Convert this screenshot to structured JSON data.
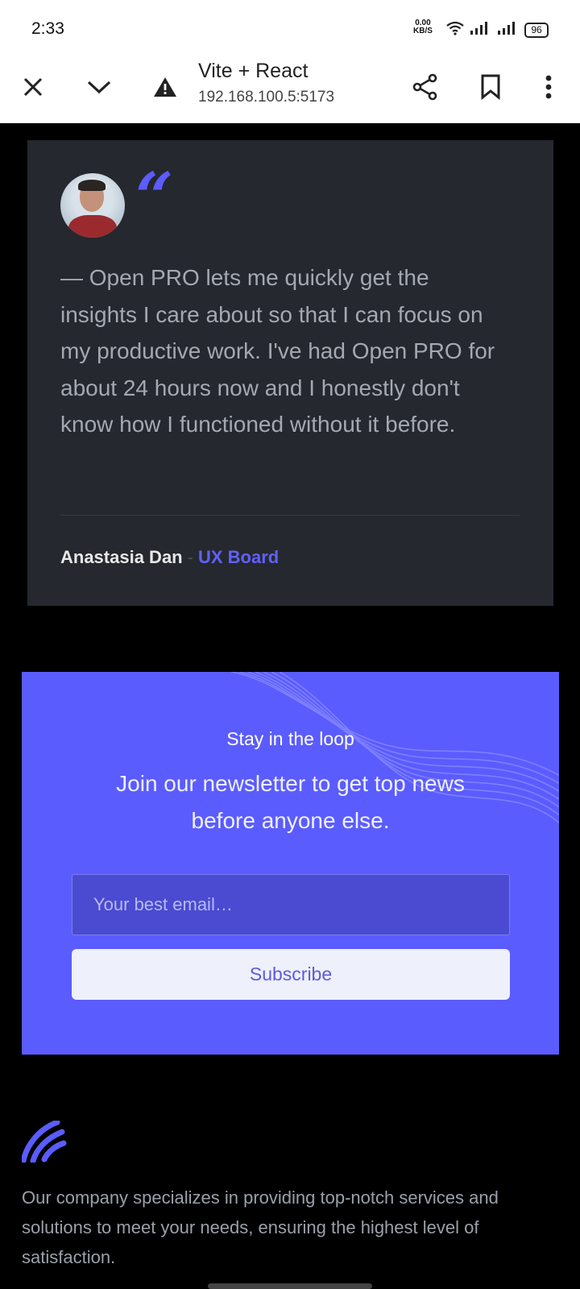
{
  "status_bar": {
    "time": "2:33",
    "net_speed_value": "0.00",
    "net_speed_unit": "KB/S",
    "battery": "96"
  },
  "browser": {
    "page_title": "Vite + React",
    "url": "192.168.100.5:5173",
    "icons": [
      "close-icon",
      "chevron-down-icon",
      "warning-icon",
      "share-icon",
      "bookmark-icon",
      "more-icon"
    ]
  },
  "testimonial": {
    "quote_mark": "“",
    "text": "— Open PRO lets me quickly get the insights I care about so that I can focus on my productive work. I've had Open PRO for about 24 hours now and I honestly don't know how I functioned without it before.",
    "author": "Anastasia Dan",
    "separator": "-",
    "company": "UX Board"
  },
  "newsletter": {
    "kicker": "Stay in the loop",
    "headline": "Join our newsletter to get top news before anyone else.",
    "email_placeholder": "Your best email…",
    "subscribe_label": "Subscribe"
  },
  "footer": {
    "description": "Our company specializes in providing top-notch services and solutions to meet your needs, ensuring the highest level of satisfaction."
  },
  "colors": {
    "accent": "#5b5cfe",
    "card_bg": "#25282e",
    "page_bg": "#000000"
  }
}
